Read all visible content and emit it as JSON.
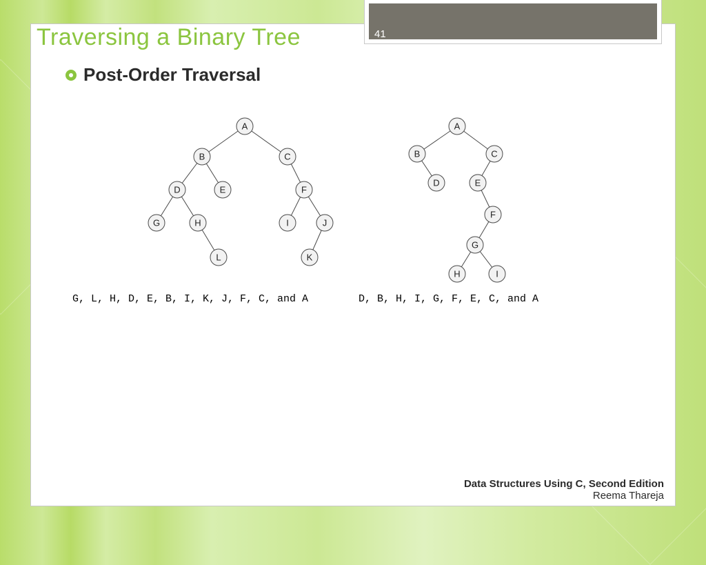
{
  "slide": {
    "number": "41",
    "title": "Traversing a Binary Tree",
    "subtitle": "Post-Order Traversal"
  },
  "tree1": {
    "nodes": [
      "A",
      "B",
      "C",
      "D",
      "E",
      "F",
      "G",
      "H",
      "I",
      "J",
      "K",
      "L"
    ],
    "edges": [
      [
        "A",
        "B"
      ],
      [
        "A",
        "C"
      ],
      [
        "B",
        "D"
      ],
      [
        "B",
        "E"
      ],
      [
        "C",
        "F"
      ],
      [
        "D",
        "G"
      ],
      [
        "D",
        "H"
      ],
      [
        "H",
        "L"
      ],
      [
        "F",
        "I"
      ],
      [
        "F",
        "J"
      ],
      [
        "J",
        "K"
      ]
    ],
    "traversal": "G, L, H, D, E, B, I, K, J, F, C, and A"
  },
  "tree2": {
    "nodes": [
      "A",
      "B",
      "C",
      "D",
      "E",
      "F",
      "G",
      "H",
      "I"
    ],
    "edges": [
      [
        "A",
        "B"
      ],
      [
        "A",
        "C"
      ],
      [
        "B",
        "D"
      ],
      [
        "C",
        "E"
      ],
      [
        "E",
        "F"
      ],
      [
        "F",
        "G"
      ],
      [
        "G",
        "H"
      ],
      [
        "G",
        "I"
      ]
    ],
    "traversal": "D, B, H, I, G, F, E, C, and A"
  },
  "footer": {
    "book": "Data Structures Using C, Second Edition",
    "author": "Reema Thareja"
  }
}
